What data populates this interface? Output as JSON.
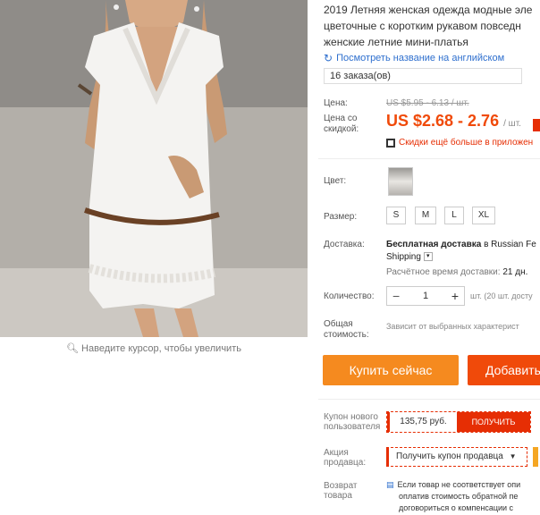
{
  "gallery": {
    "zoom_hint": "Наведите курсор, чтобы увеличить"
  },
  "product": {
    "title_lines": [
      "2019 Летняя женская одежда модные эле",
      "цветочные с коротким рукавом повседн",
      "женские летние мини-платья"
    ],
    "translate_link": "Посмотреть название на английском",
    "orders": "16 заказа(ов)"
  },
  "price": {
    "price_label": "Цена:",
    "old_price": "US $5.95 - 6.13 / шт.",
    "discount_label_1": "Цена со",
    "discount_label_2": "скидкой:",
    "new_price": "US $2.68 - 2.76",
    "unit": "/ шт.",
    "app_discount": "Скидки ещё больше в приложен"
  },
  "options": {
    "color_label": "Цвет:",
    "size_label": "Размер:",
    "sizes": [
      "S",
      "M",
      "L",
      "XL"
    ],
    "shipping_label": "Доставка:",
    "shipping_bold": "Бесплатная доставка",
    "shipping_rest": " в Russian Fe",
    "shipping_line2": "Shipping",
    "estimated_label": "Расчётное время доставки:",
    "estimated_value": "21 дн.",
    "quantity_label": "Количество:",
    "quantity_value": "1",
    "quantity_note": "шт. (20 шт. досту",
    "total_label_1": "Общая",
    "total_label_2": "стоимость:",
    "total_note": "Зависит от выбранных характерист"
  },
  "actions": {
    "buy_now": "Купить сейчас",
    "add_to_cart": "Добавить"
  },
  "promo": {
    "new_user_coupon_1": "Купон нового",
    "new_user_coupon_2": "пользователя",
    "coupon_value": "135,75 руб.",
    "coupon_button": "ПОЛУЧИТЬ",
    "seller_promo_1": "Акция",
    "seller_promo_2": "продавца:",
    "seller_coupon_select": "Получить купон продавца",
    "return_label_1": "Возврат",
    "return_label_2": "товара",
    "return_lines": [
      "Если товар не соответствует опи",
      "оплатив стоимость обратной пе",
      "договориться о компенсации с"
    ]
  },
  "colors": {
    "accent_orange": "#f58a1f",
    "accent_red": "#e62e04",
    "price_red": "#f04a0a",
    "link_blue": "#2e6fce"
  }
}
